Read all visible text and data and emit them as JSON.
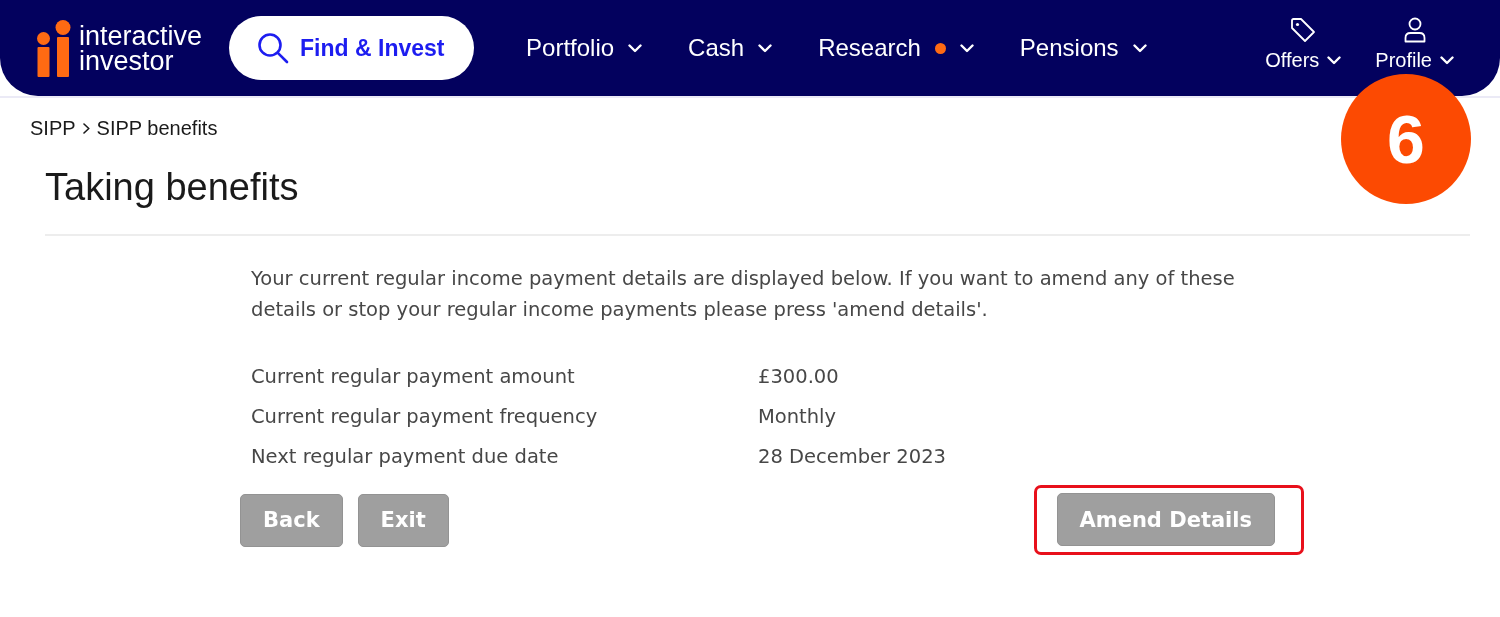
{
  "header": {
    "logo_text": "interactive investor",
    "search_button": {
      "label": "Find & Invest"
    },
    "nav": [
      {
        "label": "Portfolio",
        "notification": false
      },
      {
        "label": "Cash",
        "notification": false
      },
      {
        "label": "Research",
        "notification": true
      },
      {
        "label": "Pensions",
        "notification": false
      }
    ],
    "utility_nav": [
      {
        "kind": "offers",
        "label": "Offers"
      },
      {
        "kind": "profile",
        "label": "Profile"
      }
    ]
  },
  "step_badge": {
    "label": "6"
  },
  "breadcrumb": [
    "SIPP",
    "SIPP benefits"
  ],
  "page_title": "Taking benefits",
  "intro": "Your current regular income payment details are displayed below. If you want to amend any of these details or stop your regular income payments please press 'amend details'.",
  "details": [
    {
      "label": "Current regular payment amount",
      "value": "£300.00"
    },
    {
      "label": "Current regular payment frequency",
      "value": "Monthly"
    },
    {
      "label": "Next regular payment due date",
      "value": "28 December 2023"
    }
  ],
  "nav_buttons": [
    {
      "label": "Back",
      "highlighted": false
    },
    {
      "label": "Exit",
      "highlighted": false
    }
  ],
  "action_buttons": [
    {
      "label": "Amend Details",
      "highlighted": true
    }
  ]
}
